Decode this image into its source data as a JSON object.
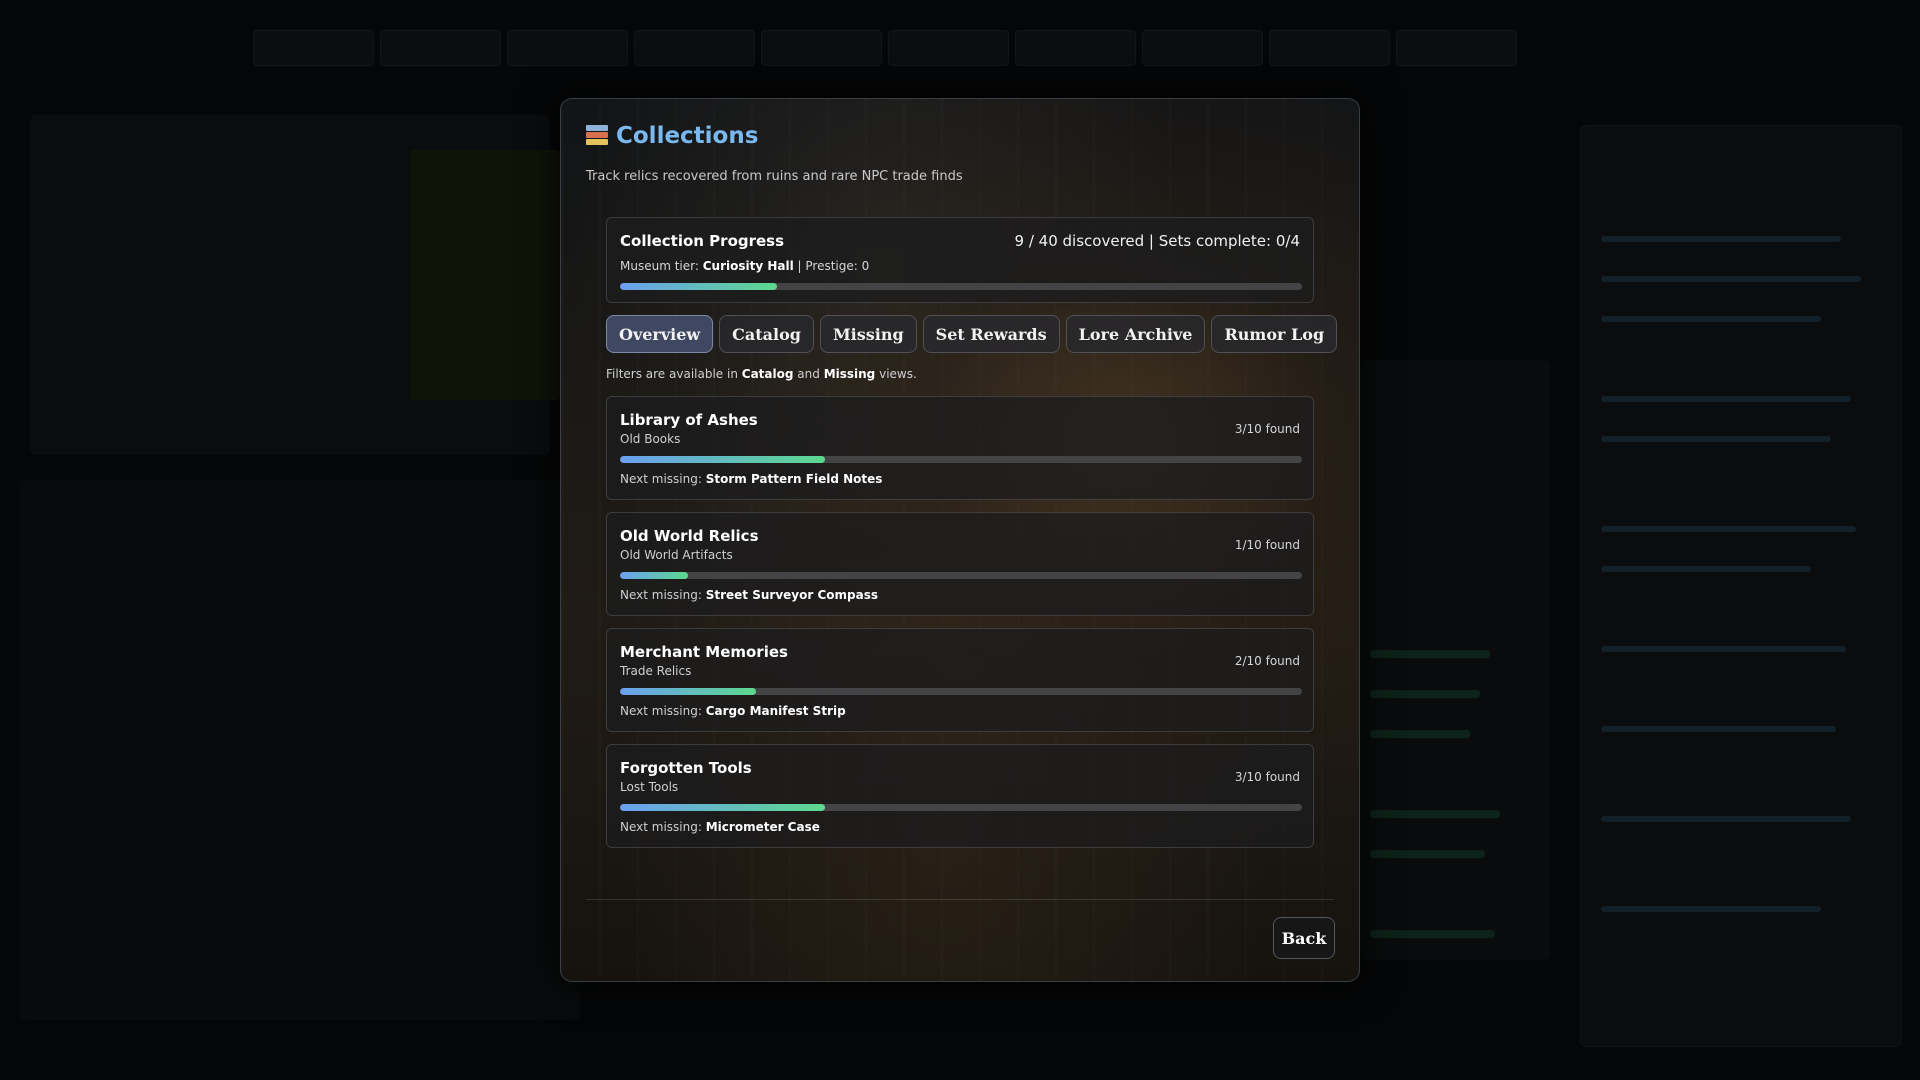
{
  "modal": {
    "title": "Collections",
    "subtitle": "Track relics recovered from ruins and rare NPC trade finds",
    "icon": "books-icon"
  },
  "progress": {
    "title": "Collection Progress",
    "stats": "9 / 40 discovered | Sets complete: 0/4",
    "tier_label": "Museum tier:",
    "tier_value": "Curiosity Hall",
    "prestige_text": "| Prestige: 0",
    "fraction": 0.23
  },
  "tabs": [
    {
      "label": "Overview",
      "active": true
    },
    {
      "label": "Catalog",
      "active": false
    },
    {
      "label": "Missing",
      "active": false
    },
    {
      "label": "Set Rewards",
      "active": false
    },
    {
      "label": "Lore Archive",
      "active": false
    },
    {
      "label": "Rumor Log",
      "active": false
    }
  ],
  "filter_note": {
    "prefix": "Filters are available in",
    "catalog": "Catalog",
    "and": "and",
    "missing": "Missing",
    "suffix": "views."
  },
  "collections": [
    {
      "name": "Library of Ashes",
      "category": "Old Books",
      "found": "3/10 found",
      "fraction": 0.3,
      "next_label": "Next missing:",
      "next_item": "Storm Pattern Field Notes"
    },
    {
      "name": "Old World Relics",
      "category": "Old World Artifacts",
      "found": "1/10 found",
      "fraction": 0.1,
      "next_label": "Next missing:",
      "next_item": "Street Surveyor Compass"
    },
    {
      "name": "Merchant Memories",
      "category": "Trade Relics",
      "found": "2/10 found",
      "fraction": 0.2,
      "next_label": "Next missing:",
      "next_item": "Cargo Manifest Strip"
    },
    {
      "name": "Forgotten Tools",
      "category": "Lost Tools",
      "found": "3/10 found",
      "fraction": 0.3,
      "next_label": "Next missing:",
      "next_item": "Micrometer Case"
    }
  ],
  "footer": {
    "back_label": "Back"
  },
  "colors": {
    "title": "#7ab8f0",
    "bar_start": "#6aa0f0",
    "bar_end": "#5cd88e",
    "track": "#444447"
  }
}
